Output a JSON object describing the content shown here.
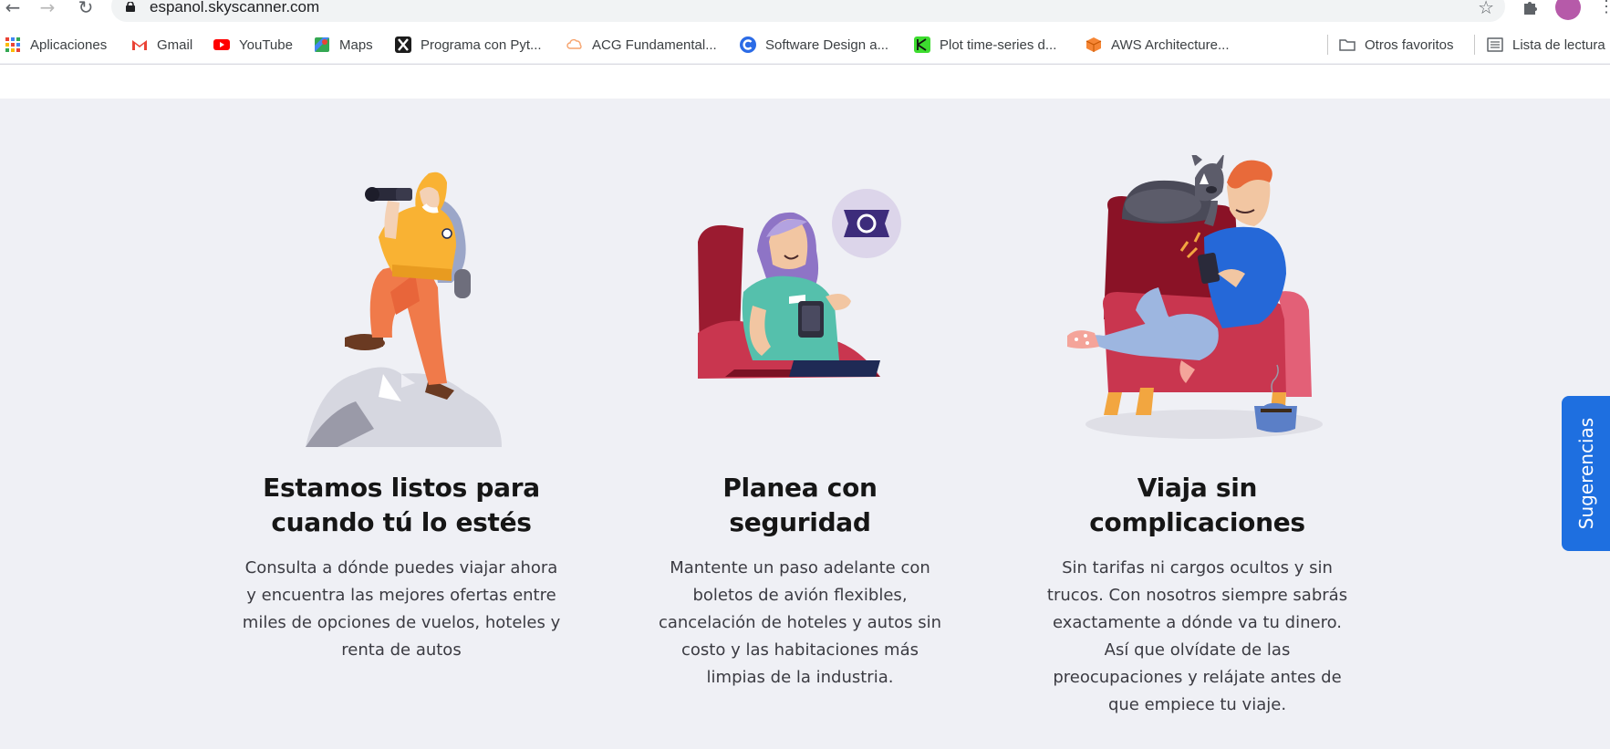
{
  "browser": {
    "url": "espanol.skyscanner.com",
    "bookmarks": [
      {
        "label": "Aplicaciones",
        "icon": "apps-grid-icon"
      },
      {
        "label": "Gmail",
        "icon": "gmail-icon"
      },
      {
        "label": "YouTube",
        "icon": "youtube-icon"
      },
      {
        "label": "Maps",
        "icon": "maps-icon"
      },
      {
        "label": "Programa con Pyt...",
        "icon": "x-logo-icon"
      },
      {
        "label": "ACG Fundamental...",
        "icon": "cloud-icon"
      },
      {
        "label": "Software Design a...",
        "icon": "c-logo-icon"
      },
      {
        "label": "Plot time-series d...",
        "icon": "plot-icon"
      },
      {
        "label": "AWS Architecture...",
        "icon": "aws-cube-icon"
      }
    ],
    "other_bookmarks": "Otros favoritos",
    "reading_list": "Lista de lectura"
  },
  "features": [
    {
      "title": "Estamos listos para cuando tú lo estés",
      "text": "Consulta a dónde puedes viajar ahora y encuentra las mejores ofertas entre miles de opciones de vuelos, hoteles y renta de autos",
      "illustration": "hiker-binoculars-illustration"
    },
    {
      "title": "Planea con seguridad",
      "text": "Mantente un paso adelante con boletos de avión flexibles, cancelación de hoteles y autos sin costo y las habitaciones más limpias de la industria.",
      "illustration": "woman-phone-armchair-illustration"
    },
    {
      "title": "Viaja sin complicaciones",
      "text": "Sin tarifas ni cargos ocultos y sin trucos. Con nosotros siempre sabrás exactamente a dónde va tu dinero. Así que olvídate de las preocupaciones y relájate antes de que empiece tu viaje.",
      "illustration": "man-dog-armchair-illustration"
    }
  ],
  "feedback_tab": "Sugerencias",
  "colors": {
    "page_bg": "#eff0f5",
    "feedback_blue": "#1e6fe0",
    "heading": "#161616"
  }
}
